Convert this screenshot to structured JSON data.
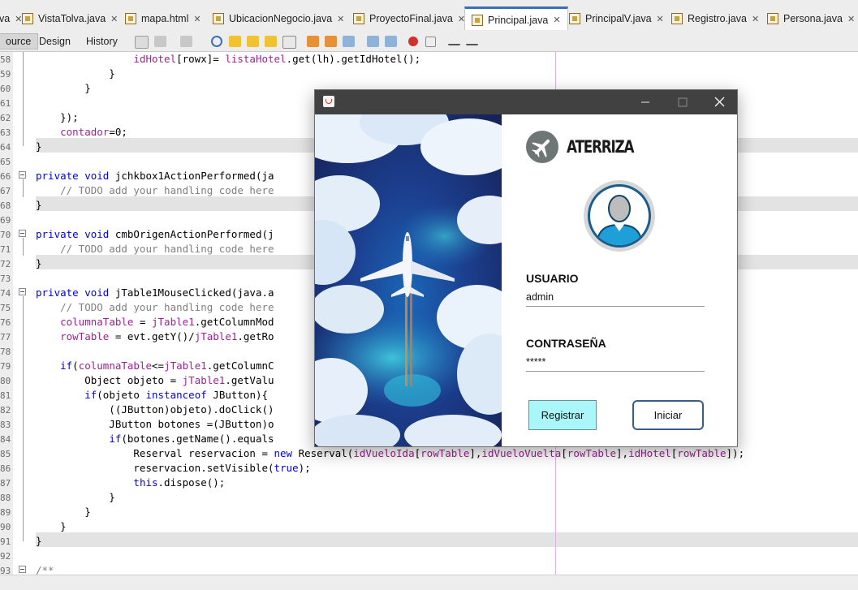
{
  "tabs": [
    {
      "label": "va"
    },
    {
      "label": "VistaTolva.java"
    },
    {
      "label": "mapa.html"
    },
    {
      "label": "UbicacionNegocio.java"
    },
    {
      "label": "ProyectoFinal.java"
    },
    {
      "label": "Principal.java"
    },
    {
      "label": "PrincipalV.java"
    },
    {
      "label": "Registro.java"
    },
    {
      "label": "Persona.java"
    }
  ],
  "active_tab": "Principal.java",
  "editor_modes": [
    "ource",
    "Design",
    "History"
  ],
  "code": [
    {
      "n": "58",
      "t": "                idHotel[rowx]= listaHotel.get(lh).getIdHotel();"
    },
    {
      "n": "59",
      "t": "            }"
    },
    {
      "n": "60",
      "t": "        }"
    },
    {
      "n": "61",
      "t": ""
    },
    {
      "n": "62",
      "t": "    });"
    },
    {
      "n": "63",
      "t": "    contador=0;"
    },
    {
      "n": "64",
      "t": "}"
    },
    {
      "n": "65",
      "t": ""
    },
    {
      "n": "66",
      "t": "private void jchkbox1ActionPerformed(ja"
    },
    {
      "n": "67",
      "t": "    // TODO add your handling code here"
    },
    {
      "n": "68",
      "t": "}"
    },
    {
      "n": "69",
      "t": ""
    },
    {
      "n": "70",
      "t": "private void cmbOrigenActionPerformed(j"
    },
    {
      "n": "71",
      "t": "    // TODO add your handling code here"
    },
    {
      "n": "72",
      "t": "}"
    },
    {
      "n": "73",
      "t": ""
    },
    {
      "n": "74",
      "t": "private void jTable1MouseClicked(java.a"
    },
    {
      "n": "75",
      "t": "    // TODO add your handling code here"
    },
    {
      "n": "76",
      "t": "    columnaTable = jTable1.getColumnMod"
    },
    {
      "n": "77",
      "t": "    rowTable = evt.getY()/jTable1.getRo"
    },
    {
      "n": "78",
      "t": ""
    },
    {
      "n": "79",
      "t": "    if(columnaTable<=jTable1.getColumnC                                    rowTable>=0){"
    },
    {
      "n": "80",
      "t": "        Object objeto = jTable1.getValu"
    },
    {
      "n": "81",
      "t": "        if(objeto instanceof JButton){"
    },
    {
      "n": "82",
      "t": "            ((JButton)objeto).doClick()"
    },
    {
      "n": "83",
      "t": "            JButton botones =(JButton)o"
    },
    {
      "n": "84",
      "t": "            if(botones.getName().equals"
    },
    {
      "n": "85",
      "t": "                Reserval reservacion = new Reserval(idVueloIda[rowTable],idVueloVuelta[rowTable],idHotel[rowTable]);"
    },
    {
      "n": "86",
      "t": "                reservacion.setVisible(true);"
    },
    {
      "n": "87",
      "t": "                this.dispose();"
    },
    {
      "n": "88",
      "t": "            }"
    },
    {
      "n": "89",
      "t": "        }"
    },
    {
      "n": "90",
      "t": "    }"
    },
    {
      "n": "91",
      "t": "}"
    },
    {
      "n": "92",
      "t": ""
    },
    {
      "n": "93",
      "t": "/**"
    }
  ],
  "login": {
    "brand": "ATERRIZA",
    "user_label": "USUARIO",
    "user_value": "admin",
    "password_label": "CONTRASEÑA",
    "password_value": "*****",
    "register_button": "Registrar",
    "login_button": "Iniciar"
  },
  "colors": {
    "register_bg": "#a9f7f8",
    "login_border": "#3a5f86",
    "titlebar": "#414141",
    "keyword": "#0000e6",
    "field": "#9b2393"
  }
}
